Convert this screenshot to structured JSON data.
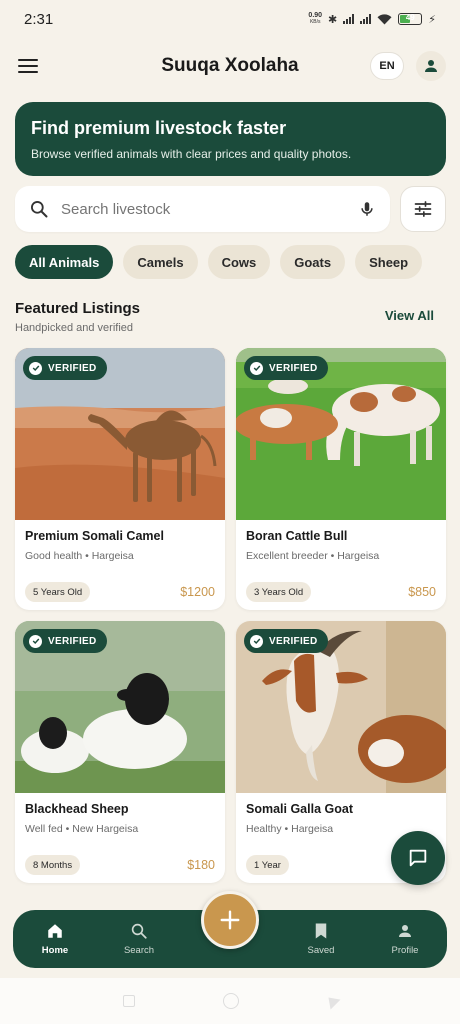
{
  "status": {
    "time": "2:31",
    "netspeed_value": "0.90",
    "netspeed_unit": "KB/s",
    "battery": "49"
  },
  "header": {
    "title": "Suuqa Xoolaha",
    "lang": "EN"
  },
  "hero": {
    "title": "Find premium livestock faster",
    "subtitle": "Browse verified animals with clear prices and quality photos."
  },
  "search": {
    "placeholder": "Search livestock"
  },
  "categories": [
    "All Animals",
    "Camels",
    "Cows",
    "Goats",
    "Sheep"
  ],
  "featured": {
    "title": "Featured Listings",
    "subtitle": "Handpicked and verified",
    "view_all": "View All"
  },
  "listings": [
    {
      "badge": "VERIFIED",
      "name": "Premium Somali Camel",
      "meta": "Good health • Hargeisa",
      "age": "5 Years Old",
      "price": "$1200"
    },
    {
      "badge": "VERIFIED",
      "name": "Boran Cattle Bull",
      "meta": "Excellent breeder • Hargeisa",
      "age": "3 Years Old",
      "price": "$850"
    },
    {
      "badge": "VERIFIED",
      "name": "Blackhead Sheep",
      "meta": "Well fed • New Hargeisa",
      "age": "8 Months",
      "price": "$180"
    },
    {
      "badge": "VERIFIED",
      "name": "Somali Galla Goat",
      "meta": "Healthy • Hargeisa",
      "age": "1 Year",
      "price": ""
    }
  ],
  "nav": {
    "home": "Home",
    "search": "Search",
    "saved": "Saved",
    "profile": "Profile"
  },
  "colors": {
    "primary": "#1b4b3b",
    "accent": "#c9974e",
    "background": "#f6f2ea",
    "chip": "#ebe4d5"
  }
}
